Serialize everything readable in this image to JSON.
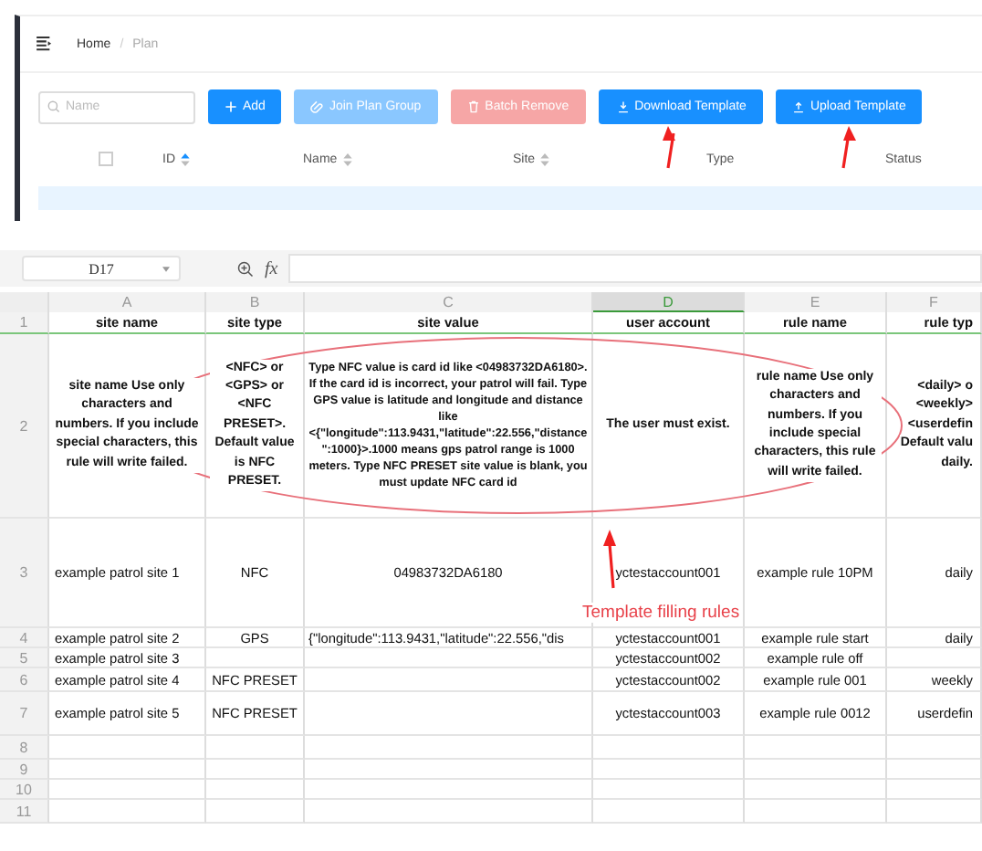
{
  "breadcrumb": [
    {
      "label": "Home",
      "selected": false
    },
    {
      "separator": "/",
      "label": "Plan",
      "selected": true
    }
  ],
  "search": {
    "placeholder": "Name"
  },
  "toolbar": [
    {
      "label": "Add",
      "kind": "add",
      "disabled": false
    },
    {
      "label": "Join Plan Group",
      "kind": "join",
      "disabled": true
    },
    {
      "label": "Batch Remove",
      "kind": "remove",
      "disabled": true
    },
    {
      "label": "Download Template",
      "kind": "download",
      "disabled": false
    },
    {
      "label": "Upload Template",
      "kind": "upload",
      "disabled": false
    }
  ],
  "table": {
    "select_all_checked": false,
    "columns": [
      {
        "label": "ID",
        "sorted_ascending": true
      },
      {
        "label": "Name",
        "sorted_ascending": false
      },
      {
        "label": "Site",
        "sorted_ascending": false
      },
      {
        "label": "Type"
      },
      {
        "label": "Status"
      }
    ]
  },
  "spreadsheet": {
    "cell_ref": "D17",
    "formula_label": "fx",
    "column_letters": [
      {
        "label": "A",
        "selected": false
      },
      {
        "label": "B",
        "selected": false
      },
      {
        "label": "C",
        "selected": false
      },
      {
        "label": "D",
        "selected": true
      },
      {
        "label": "E",
        "selected": false
      },
      {
        "label": "F",
        "selected": false
      }
    ],
    "rows": [
      {
        "number": "1",
        "kind": "header",
        "cells": {
          "A": "site name",
          "B": "site type",
          "C": "site value",
          "D": "user account",
          "E": "rule name",
          "F": "rule typ"
        }
      },
      {
        "number": "2",
        "kind": "notes",
        "cells": {
          "A": "site name Use only characters and numbers. If you include special characters, this rule will write failed.",
          "B": "<NFC> or <GPS> or <NFC PRESET>. Default value is NFC PRESET.",
          "C": "Type NFC value is card id like <04983732DA6180>. If the card id is incorrect, your patrol will fail.  Type GPS value is latitude and longitude and distance like <{\"longitude\":113.9431,\"latitude\":22.556,\"distance\":1000}>.1000 means gps patrol range is 1000 meters.  Type NFC PRESET site value is blank, you must update NFC card id",
          "D": "The user must exist.",
          "E": "rule name Use only characters and numbers. If you include special characters, this rule will write failed.",
          "F": [
            "<daily> o",
            "<weekly>",
            "<userdefin",
            "Default valu",
            "daily."
          ]
        }
      },
      {
        "number": "3",
        "kind": "data",
        "cells": {
          "A": "example patrol site 1",
          "B": "NFC",
          "C": "04983732DA6180",
          "D": "yctestaccount001",
          "E": "example rule 10PM",
          "F": "daily"
        }
      },
      {
        "number": "4",
        "kind": "data",
        "cells": {
          "A": "example patrol site 2",
          "B": "GPS",
          "C": "{\"longitude\":113.9431,\"latitude\":22.556,\"dis",
          "D": "yctestaccount001",
          "E": "example rule start",
          "F": "daily"
        }
      },
      {
        "number": "5",
        "kind": "data",
        "cells": {
          "A": "example patrol site 3",
          "D": "yctestaccount002",
          "E": "example rule off"
        }
      },
      {
        "number": "6",
        "kind": "data",
        "cells": {
          "A": "example patrol site 4",
          "B": "NFC PRESET",
          "D": "yctestaccount002",
          "E": "example rule 001",
          "F": "weekly"
        }
      },
      {
        "number": "7",
        "kind": "data",
        "cells": {
          "A": "example patrol site 5",
          "B": "NFC PRESET",
          "D": "yctestaccount003",
          "E": "example rule 0012",
          "F": "userdefin"
        }
      },
      {
        "number": "8",
        "kind": "data",
        "cells": {}
      },
      {
        "number": "9",
        "kind": "data",
        "cells": {}
      },
      {
        "number": "10",
        "kind": "data",
        "cells": {}
      },
      {
        "number": "11",
        "kind": "data",
        "cells": {}
      }
    ]
  },
  "annotation": {
    "caption": "Template filling rules"
  }
}
